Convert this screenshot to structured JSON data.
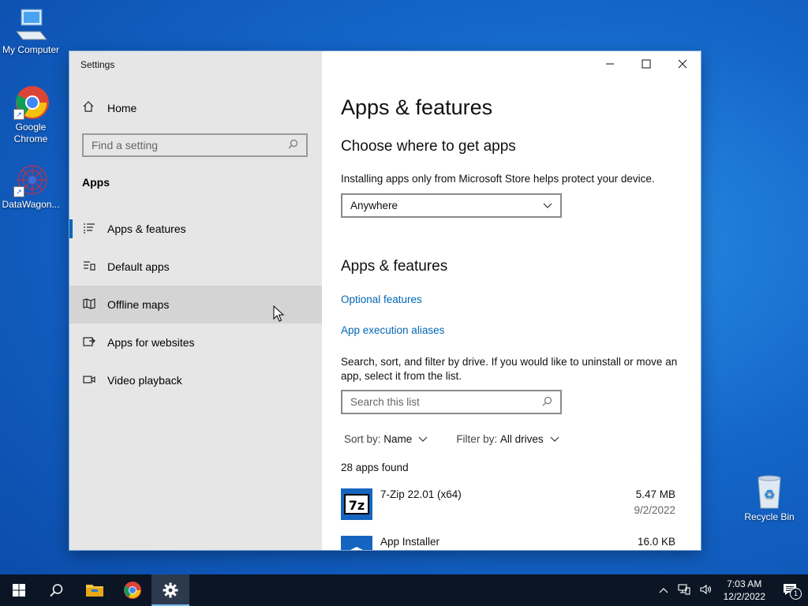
{
  "desktop": {
    "icons": [
      {
        "label": "My Computer"
      },
      {
        "label": "Google Chrome"
      },
      {
        "label": "DataWagon..."
      },
      {
        "label": "Recycle Bin"
      }
    ]
  },
  "window": {
    "title": "Settings",
    "controls": {
      "minimize": "—",
      "maximize": "☐",
      "close": "✕"
    }
  },
  "sidebar": {
    "home_label": "Home",
    "search_placeholder": "Find a setting",
    "section": "Apps",
    "items": [
      {
        "label": "Apps & features",
        "icon": "list-icon"
      },
      {
        "label": "Default apps",
        "icon": "default-apps-icon"
      },
      {
        "label": "Offline maps",
        "icon": "map-icon"
      },
      {
        "label": "Apps for websites",
        "icon": "link-icon"
      },
      {
        "label": "Video playback",
        "icon": "video-icon"
      }
    ]
  },
  "content": {
    "page_title": "Apps & features",
    "choose_heading": "Choose where to get apps",
    "choose_desc": "Installing apps only from Microsoft Store helps protect your device.",
    "source_selected": "Anywhere",
    "features_heading": "Apps & features",
    "optional_features": "Optional features",
    "execution_aliases": "App execution aliases",
    "search_desc": "Search, sort, and filter by drive. If you would like to uninstall or move an app, select it from the list.",
    "search_placeholder": "Search this list",
    "sort_label": "Sort by:",
    "sort_value": "Name",
    "filter_label": "Filter by:",
    "filter_value": "All drives",
    "apps_found": "28 apps found",
    "apps": [
      {
        "name": "7-Zip 22.01 (x64)",
        "size": "5.47 MB",
        "date": "9/2/2022"
      },
      {
        "name": "App Installer",
        "size": "16.0 KB",
        "date": ""
      }
    ]
  },
  "taskbar": {
    "time": "7:03 AM",
    "date": "12/2/2022",
    "notification_count": "1"
  },
  "colors": {
    "accent": "#0067c0",
    "link": "#0067b8",
    "taskbar": "#0b1524"
  }
}
